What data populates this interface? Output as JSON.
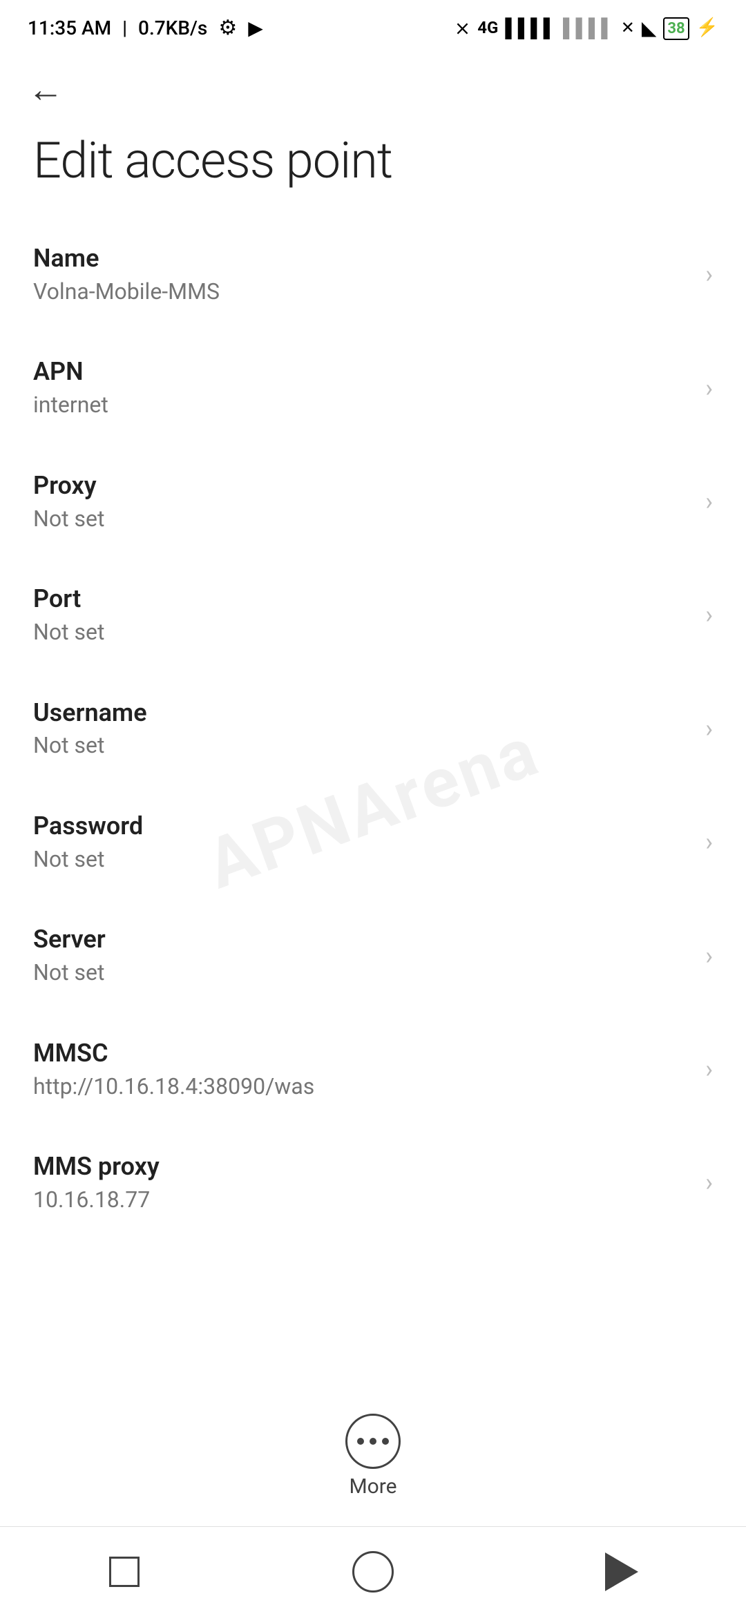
{
  "statusBar": {
    "time": "11:35 AM",
    "network_speed": "0.7KB/s",
    "battery_level": "38"
  },
  "toolbar": {
    "back_label": "←"
  },
  "page": {
    "title": "Edit access point"
  },
  "settings_items": [
    {
      "label": "Name",
      "value": "Volna-Mobile-MMS"
    },
    {
      "label": "APN",
      "value": "internet"
    },
    {
      "label": "Proxy",
      "value": "Not set"
    },
    {
      "label": "Port",
      "value": "Not set"
    },
    {
      "label": "Username",
      "value": "Not set"
    },
    {
      "label": "Password",
      "value": "Not set"
    },
    {
      "label": "Server",
      "value": "Not set"
    },
    {
      "label": "MMSC",
      "value": "http://10.16.18.4:38090/was"
    },
    {
      "label": "MMS proxy",
      "value": "10.16.18.77"
    }
  ],
  "more_button": {
    "label": "More"
  },
  "nav_bar": {
    "square_label": "recent-apps",
    "circle_label": "home",
    "triangle_label": "back"
  },
  "watermark": "APNArena"
}
